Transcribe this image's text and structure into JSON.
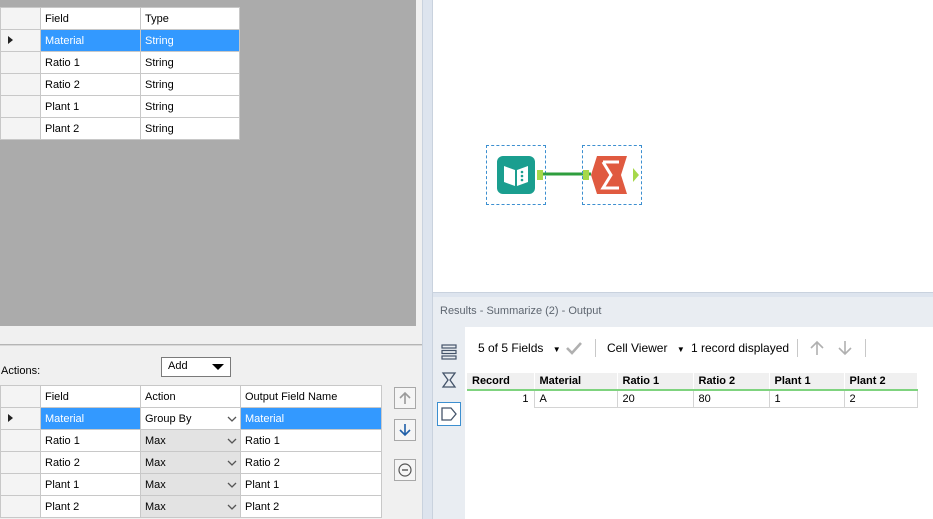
{
  "fields_table": {
    "headers": [
      "Field",
      "Type"
    ],
    "rows": [
      {
        "field": "Material",
        "type": "String"
      },
      {
        "field": "Ratio 1",
        "type": "String"
      },
      {
        "field": "Ratio 2",
        "type": "String"
      },
      {
        "field": "Plant 1",
        "type": "String"
      },
      {
        "field": "Plant 2",
        "type": "String"
      }
    ]
  },
  "actions": {
    "label": "Actions:",
    "add_button": "Add",
    "headers": [
      "Field",
      "Action",
      "Output Field Name"
    ],
    "rows": [
      {
        "field": "Material",
        "action": "Group By",
        "output": "Material"
      },
      {
        "field": "Ratio 1",
        "action": "Max",
        "output": "Ratio 1"
      },
      {
        "field": "Ratio 2",
        "action": "Max",
        "output": "Ratio 2"
      },
      {
        "field": "Plant 1",
        "action": "Max",
        "output": "Plant 1"
      },
      {
        "field": "Plant 2",
        "action": "Max",
        "output": "Plant 2"
      }
    ]
  },
  "results": {
    "title": "Results - Summarize (2) - Output",
    "fields_label": "5 of 5 Fields",
    "viewer_label": "Cell Viewer",
    "records_label": "1 record displayed",
    "headers": [
      "Record",
      "Material",
      "Ratio 1",
      "Ratio 2",
      "Plant 1",
      "Plant 2"
    ],
    "row": [
      "1",
      "A",
      "20",
      "80",
      "1",
      "2"
    ]
  },
  "colors": {
    "selection": "#3399ff",
    "input_tool": "#1a9e8f",
    "summarize_tool": "#e05a40",
    "connector": "#2e9e3e",
    "header_underline": "#7fd37f"
  },
  "icons": [
    "input-data-tool-icon",
    "summarize-tool-icon",
    "move-up-icon",
    "move-down-icon",
    "remove-icon",
    "list-view-icon",
    "sigma-icon",
    "tag-icon",
    "check-icon",
    "arrow-up-icon",
    "arrow-down-icon"
  ]
}
